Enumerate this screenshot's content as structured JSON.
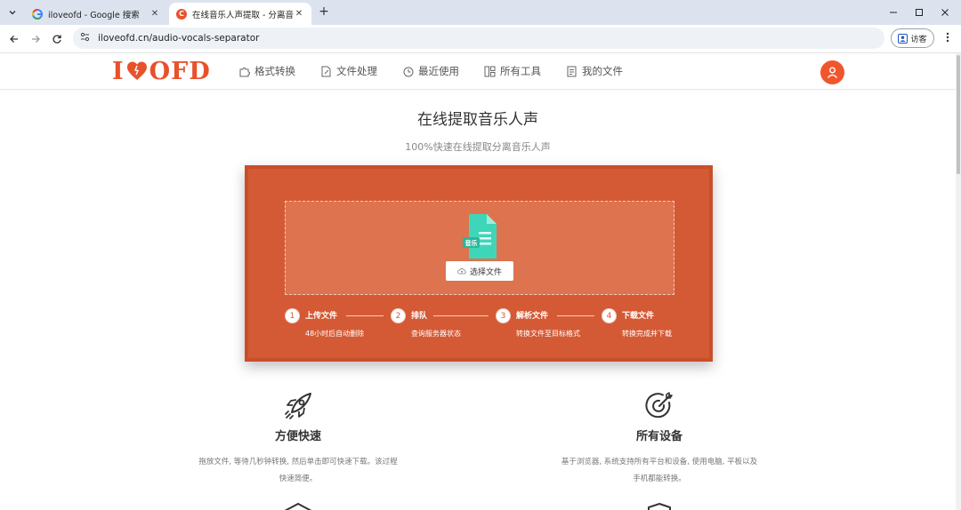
{
  "browser": {
    "tabs": [
      {
        "title": "iloveofd - Google 搜索",
        "active": false,
        "favicon": "google-icon"
      },
      {
        "title": "在线音乐人声提取 - 分离音频人声",
        "active": true,
        "favicon": "site-icon"
      }
    ],
    "url": "iloveofd.cn/audio-vocals-separator",
    "guest_label": "访客"
  },
  "site": {
    "logo_left": "I",
    "logo_right": "OFD",
    "nav": [
      {
        "label": "格式转换",
        "icon": "puzzle-icon"
      },
      {
        "label": "文件处理",
        "icon": "file-edit-icon"
      },
      {
        "label": "最近使用",
        "icon": "recent-icon"
      },
      {
        "label": "所有工具",
        "icon": "grid-icon"
      },
      {
        "label": "我的文件",
        "icon": "document-icon"
      }
    ]
  },
  "main": {
    "title": "在线提取音乐人声",
    "subtitle": "100%快速在线提取分离音乐人声",
    "file_icon_label": "音乐",
    "select_button": "选择文件",
    "steps": [
      {
        "num": "1",
        "title": "上传文件",
        "desc": "48小时后自动删除"
      },
      {
        "num": "2",
        "title": "排队",
        "desc": "查询服务器状态"
      },
      {
        "num": "3",
        "title": "解析文件",
        "desc": "转换文件至目标格式"
      },
      {
        "num": "4",
        "title": "下载文件",
        "desc": "转换完成并下载"
      }
    ],
    "features": [
      {
        "title": "方便快速",
        "desc": "拖放文件, 等待几秒钟转换, 然后单击即可快速下载。该过程快速简便。",
        "icon": "rocket-icon"
      },
      {
        "title": "所有设备",
        "desc": "基于浏览器, 系统支持所有平台和设备, 使用电脑, 平板以及手机都能转换。",
        "icon": "target-icon"
      }
    ]
  },
  "colors": {
    "brand": "#e8522a",
    "panel": "#d45a35",
    "dropzone": "#dd744f",
    "file_icon": "#3ed6b8"
  }
}
